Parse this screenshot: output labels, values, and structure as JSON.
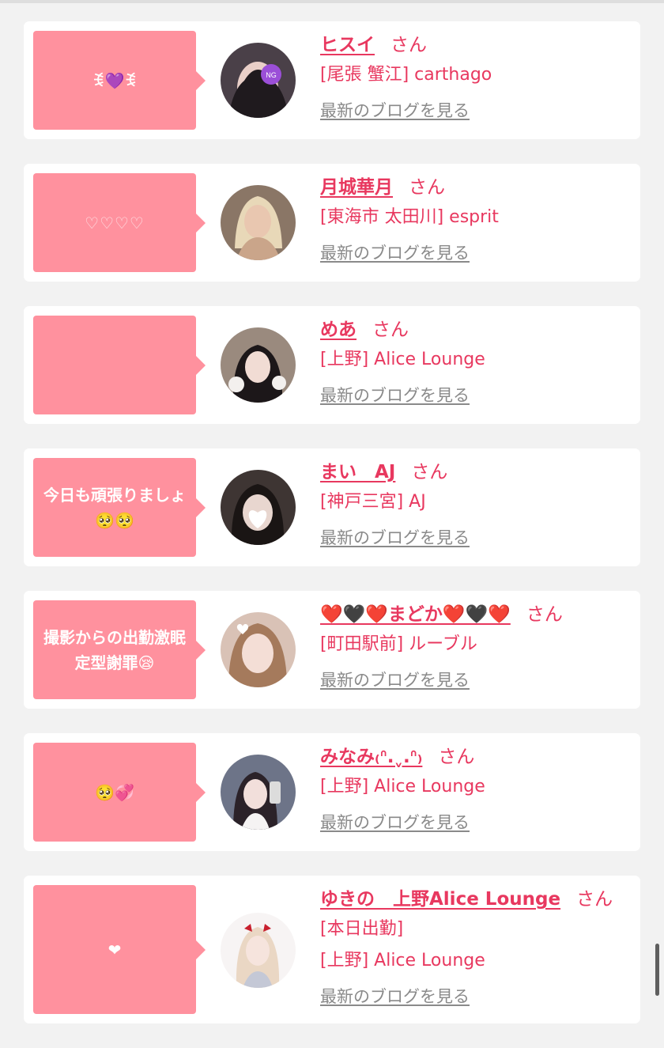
{
  "san_suffix": "さん",
  "blog_link_label": "最新のブログを見る",
  "colors": {
    "background": "#f2f2f2",
    "card": "#ffffff",
    "bubble": "#ff919e",
    "accent_text": "#e8385f",
    "link_gray": "#8a8a8a"
  },
  "cards": [
    {
      "message": "ꉂ💜ꉂ",
      "name": "ヒスイ",
      "shop_lines": [
        "[尾張 蟹江] carthago"
      ],
      "avatar_icon": "avatar-photo-icon"
    },
    {
      "message": "♡♡♡♡",
      "name": "月城華月",
      "shop_lines": [
        "[東海市 太田川] esprit"
      ],
      "avatar_icon": "avatar-photo-icon"
    },
    {
      "message": "",
      "name": "めあ",
      "shop_lines": [
        "[上野] Alice Lounge"
      ],
      "avatar_icon": "avatar-photo-icon"
    },
    {
      "message": "今日も頑張りましょ🥺🥺",
      "name": "まい　AJ",
      "shop_lines": [
        "[神戸三宮] AJ"
      ],
      "avatar_icon": "avatar-photo-icon"
    },
    {
      "message": "撮影からの出勤激眠定型謝罪😪",
      "name": "❤️🖤❤️まどか❤️🖤❤️",
      "shop_lines": [
        "[町田駅前] ルーブル"
      ],
      "avatar_icon": "avatar-photo-icon"
    },
    {
      "message": "🥺💞",
      "name": "みなみ₍ᐢ.ˬ.ᐢ₎",
      "shop_lines": [
        "[上野] Alice Lounge"
      ],
      "avatar_icon": "avatar-photo-icon"
    },
    {
      "message": "❤",
      "name": "ゆきの　上野Alice Lounge",
      "shop_lines": [
        "[本日出勤]",
        "[上野] Alice Lounge"
      ],
      "avatar_icon": "avatar-photo-icon"
    }
  ]
}
